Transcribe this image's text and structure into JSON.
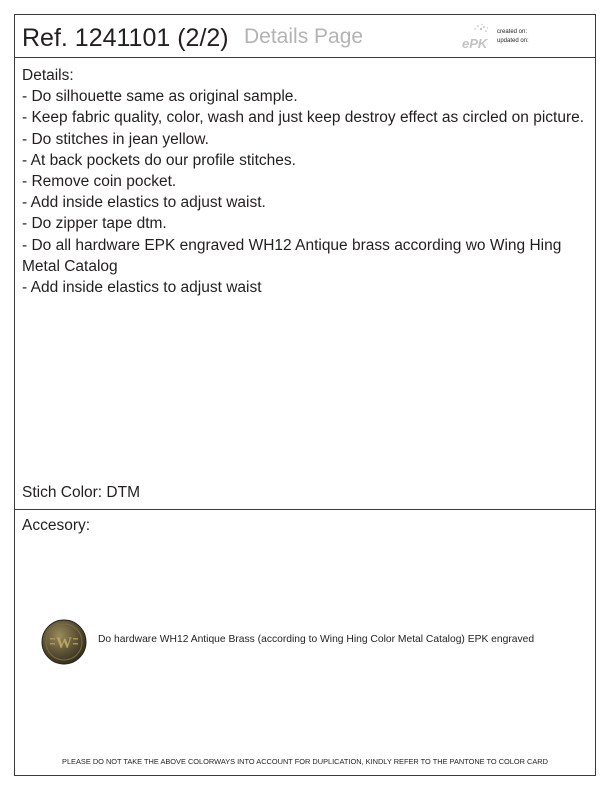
{
  "header": {
    "ref": "Ref. 1241101 (2/2)",
    "page_label": "Details Page",
    "logo_text": "ePK",
    "created_label": "created on:",
    "updated_label": "updated on:"
  },
  "details": {
    "heading": "Details:",
    "lines": [
      "- Do silhouette same as original sample.",
      "- Keep fabric quality, color, wash and just keep destroy effect as circled on picture.",
      "- Do stitches in jean yellow.",
      "- At back pockets do our profile stitches.",
      "- Remove coin pocket.",
      "- Add inside elastics to adjust waist.",
      "- Do zipper tape dtm.",
      "- Do all hardware EPK engraved WH12 Antique brass according wo Wing Hing Metal Catalog",
      "- Add inside elastics to adjust waist"
    ],
    "stitch_color": "Stich Color: DTM"
  },
  "accessory": {
    "title": "Accesory:",
    "button_engraving": "W",
    "hardware_note": "Do hardware WH12 Antique Brass (according to Wing Hing Color Metal Catalog) EPK engraved"
  },
  "footer": {
    "disclaimer": "PLEASE DO NOT TAKE THE ABOVE COLORWAYS INTO ACCOUNT FOR DUPLICATION, KINDLY REFER TO THE PANTONE TO COLOR CARD"
  },
  "colors": {
    "border": "#3a3a3a",
    "text": "#231f20",
    "muted_label": "#b3b3b3",
    "antique_brass": "#8a7a4a"
  }
}
